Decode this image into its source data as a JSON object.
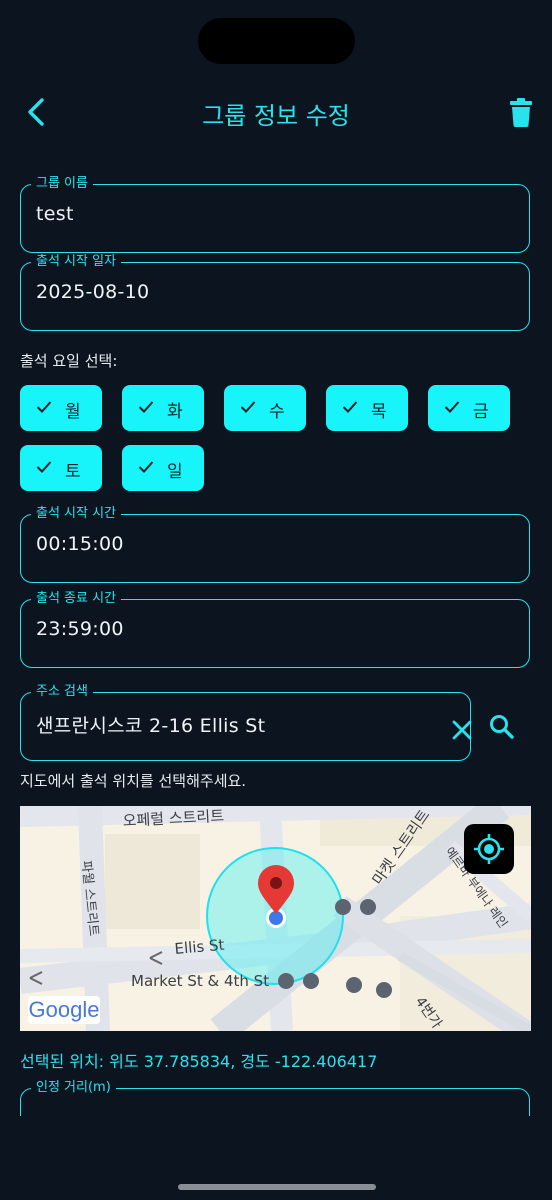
{
  "header": {
    "title": "그룹 정보 수정",
    "back_icon": "chevron-left-icon",
    "delete_icon": "trash-icon"
  },
  "colors": {
    "background": "#0c1420",
    "accent": "#28e3ec",
    "chip": "#17f5fb"
  },
  "group_name": {
    "label": "그룹 이름",
    "value": "test"
  },
  "start_date": {
    "label": "출석 시작 일자",
    "value": "2025-08-10"
  },
  "days": {
    "label": "출석 요일 선택:",
    "items": [
      {
        "label": "월",
        "selected": true
      },
      {
        "label": "화",
        "selected": true
      },
      {
        "label": "수",
        "selected": true
      },
      {
        "label": "목",
        "selected": true
      },
      {
        "label": "금",
        "selected": true
      },
      {
        "label": "토",
        "selected": true
      },
      {
        "label": "일",
        "selected": true
      }
    ]
  },
  "start_time": {
    "label": "출석 시작 시간",
    "value": "00:15:00"
  },
  "end_time": {
    "label": "출석 종료 시간",
    "value": "23:59:00"
  },
  "address": {
    "label": "주소 검색",
    "value": "샌프란시스코 2-16 Ellis St",
    "clear_icon": "close-icon",
    "search_icon": "search-icon"
  },
  "map_hint": "지도에서 출석 위치를 선택해주세요.",
  "map": {
    "streets": {
      "opera": "오페럴 스트리트",
      "market": "마켓 스트리트",
      "powell": "파월 스트리트",
      "ellis": "Ellis St",
      "market_4th": "Market St & 4th St",
      "yerba": "예르바 부에나 레인",
      "fourth": "4번가"
    },
    "google_logo": "Google",
    "locate_icon": "my-location-icon"
  },
  "selected_location": "선택된 위치: 위도 37.785834, 경도 -122.406417",
  "radius": {
    "label": "인정 거리(m)"
  }
}
